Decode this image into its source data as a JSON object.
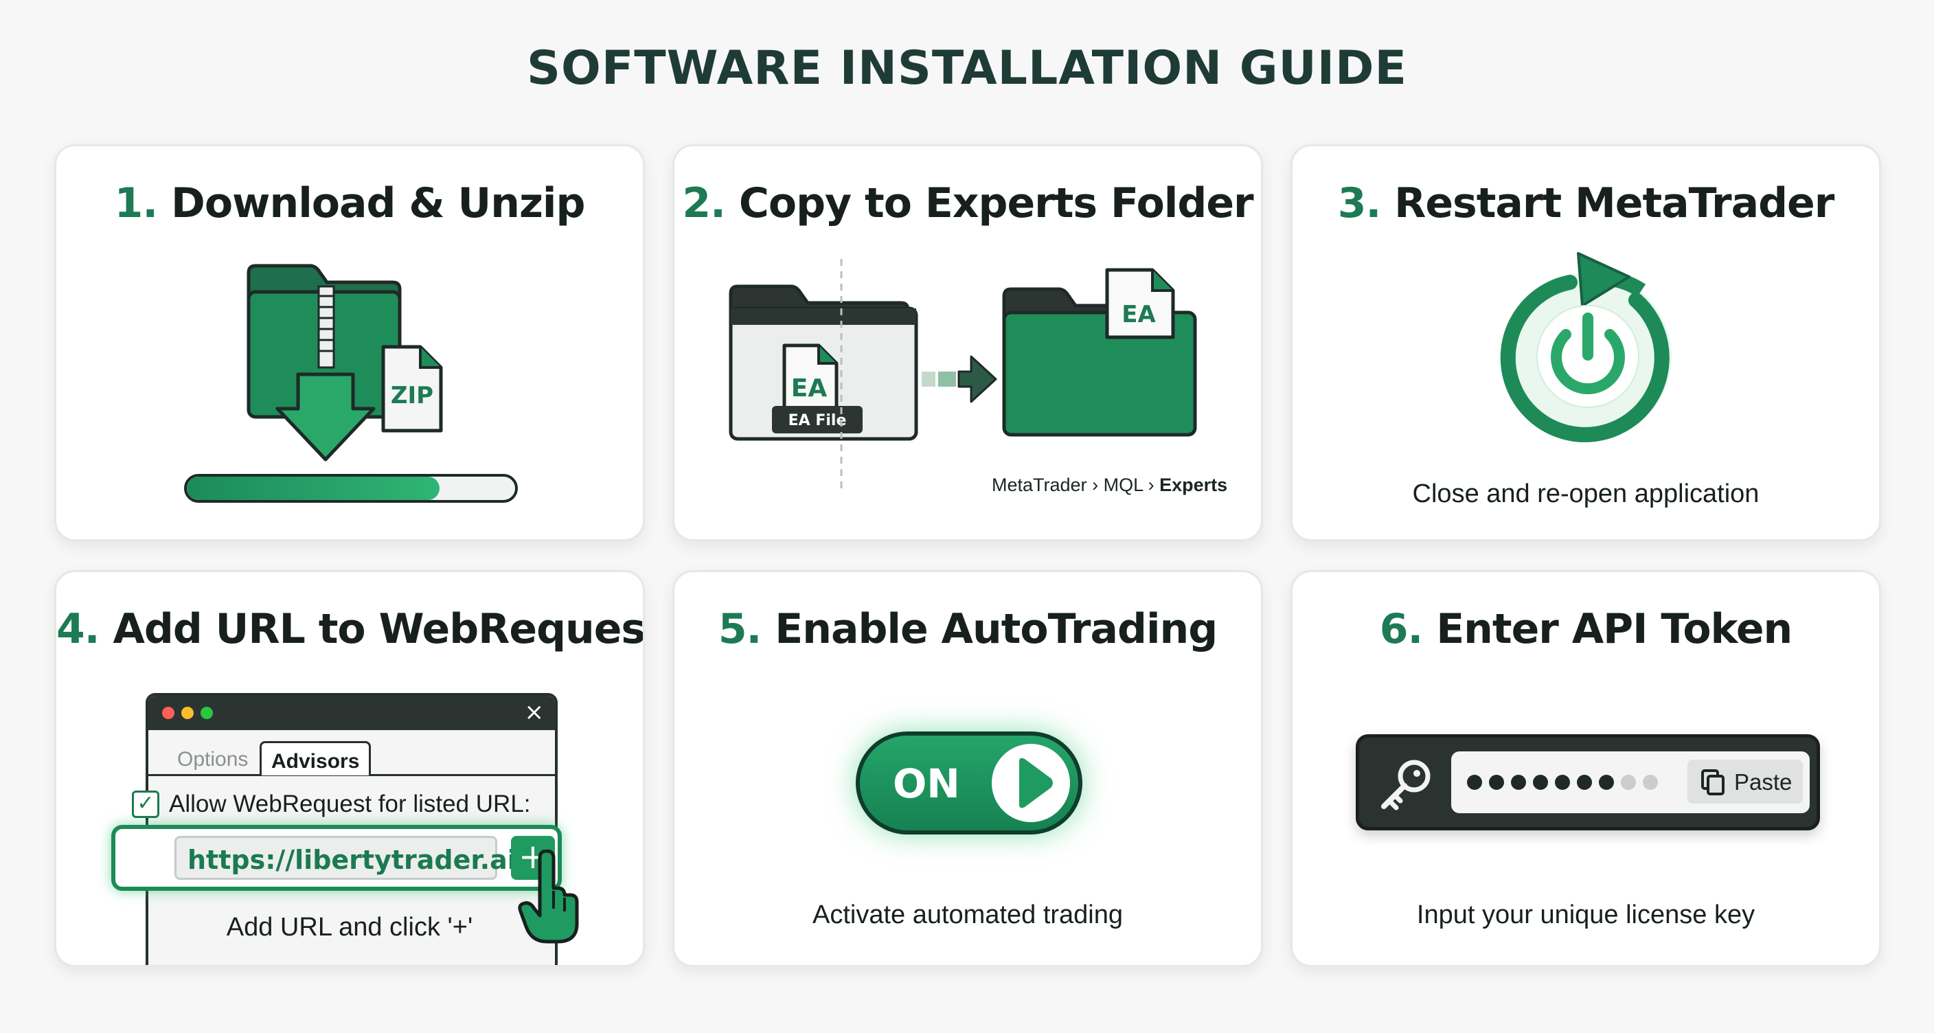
{
  "title": "SOFTWARE INSTALLATION GUIDE",
  "colors": {
    "accent": "#1d7a55",
    "accent_bright": "#2fb574",
    "dark": "#1f2a27",
    "card_bg": "#ffffff",
    "page_bg": "#f6f7f6"
  },
  "steps": [
    {
      "number": "1.",
      "title": "Download & Unzip",
      "icon": "zip-folder-download-icon",
      "zip_label": "ZIP",
      "progress": 0.77
    },
    {
      "number": "2.",
      "title": "Copy to Experts Folder",
      "ea_label": "EA",
      "ea_file_label": "EA File",
      "path": [
        "MetaTrader",
        "MQL",
        "Experts"
      ],
      "path_sep": "›"
    },
    {
      "number": "3.",
      "title": "Restart MetaTrader",
      "icon": "restart-power-icon",
      "caption": "Close and re-open application"
    },
    {
      "number": "4.",
      "title": "Add URL to WebRequest",
      "tabs": [
        "Options",
        "Advisors"
      ],
      "active_tab": "Advisors",
      "checkbox_label": "Allow WebRequest for listed URL:",
      "checkbox_checked": true,
      "url": "https://libertytrader.ai",
      "add_symbol": "+",
      "caption": "Add URL and click '+'"
    },
    {
      "number": "5.",
      "title": "Enable AutoTrading",
      "toggle_label": "ON",
      "toggle_on": true,
      "caption": "Activate automated trading"
    },
    {
      "number": "6.",
      "title": "Enter API Token",
      "paste_label": "Paste",
      "masked_filled": 7,
      "masked_empty": 2,
      "caption": "Input your unique license key"
    }
  ]
}
